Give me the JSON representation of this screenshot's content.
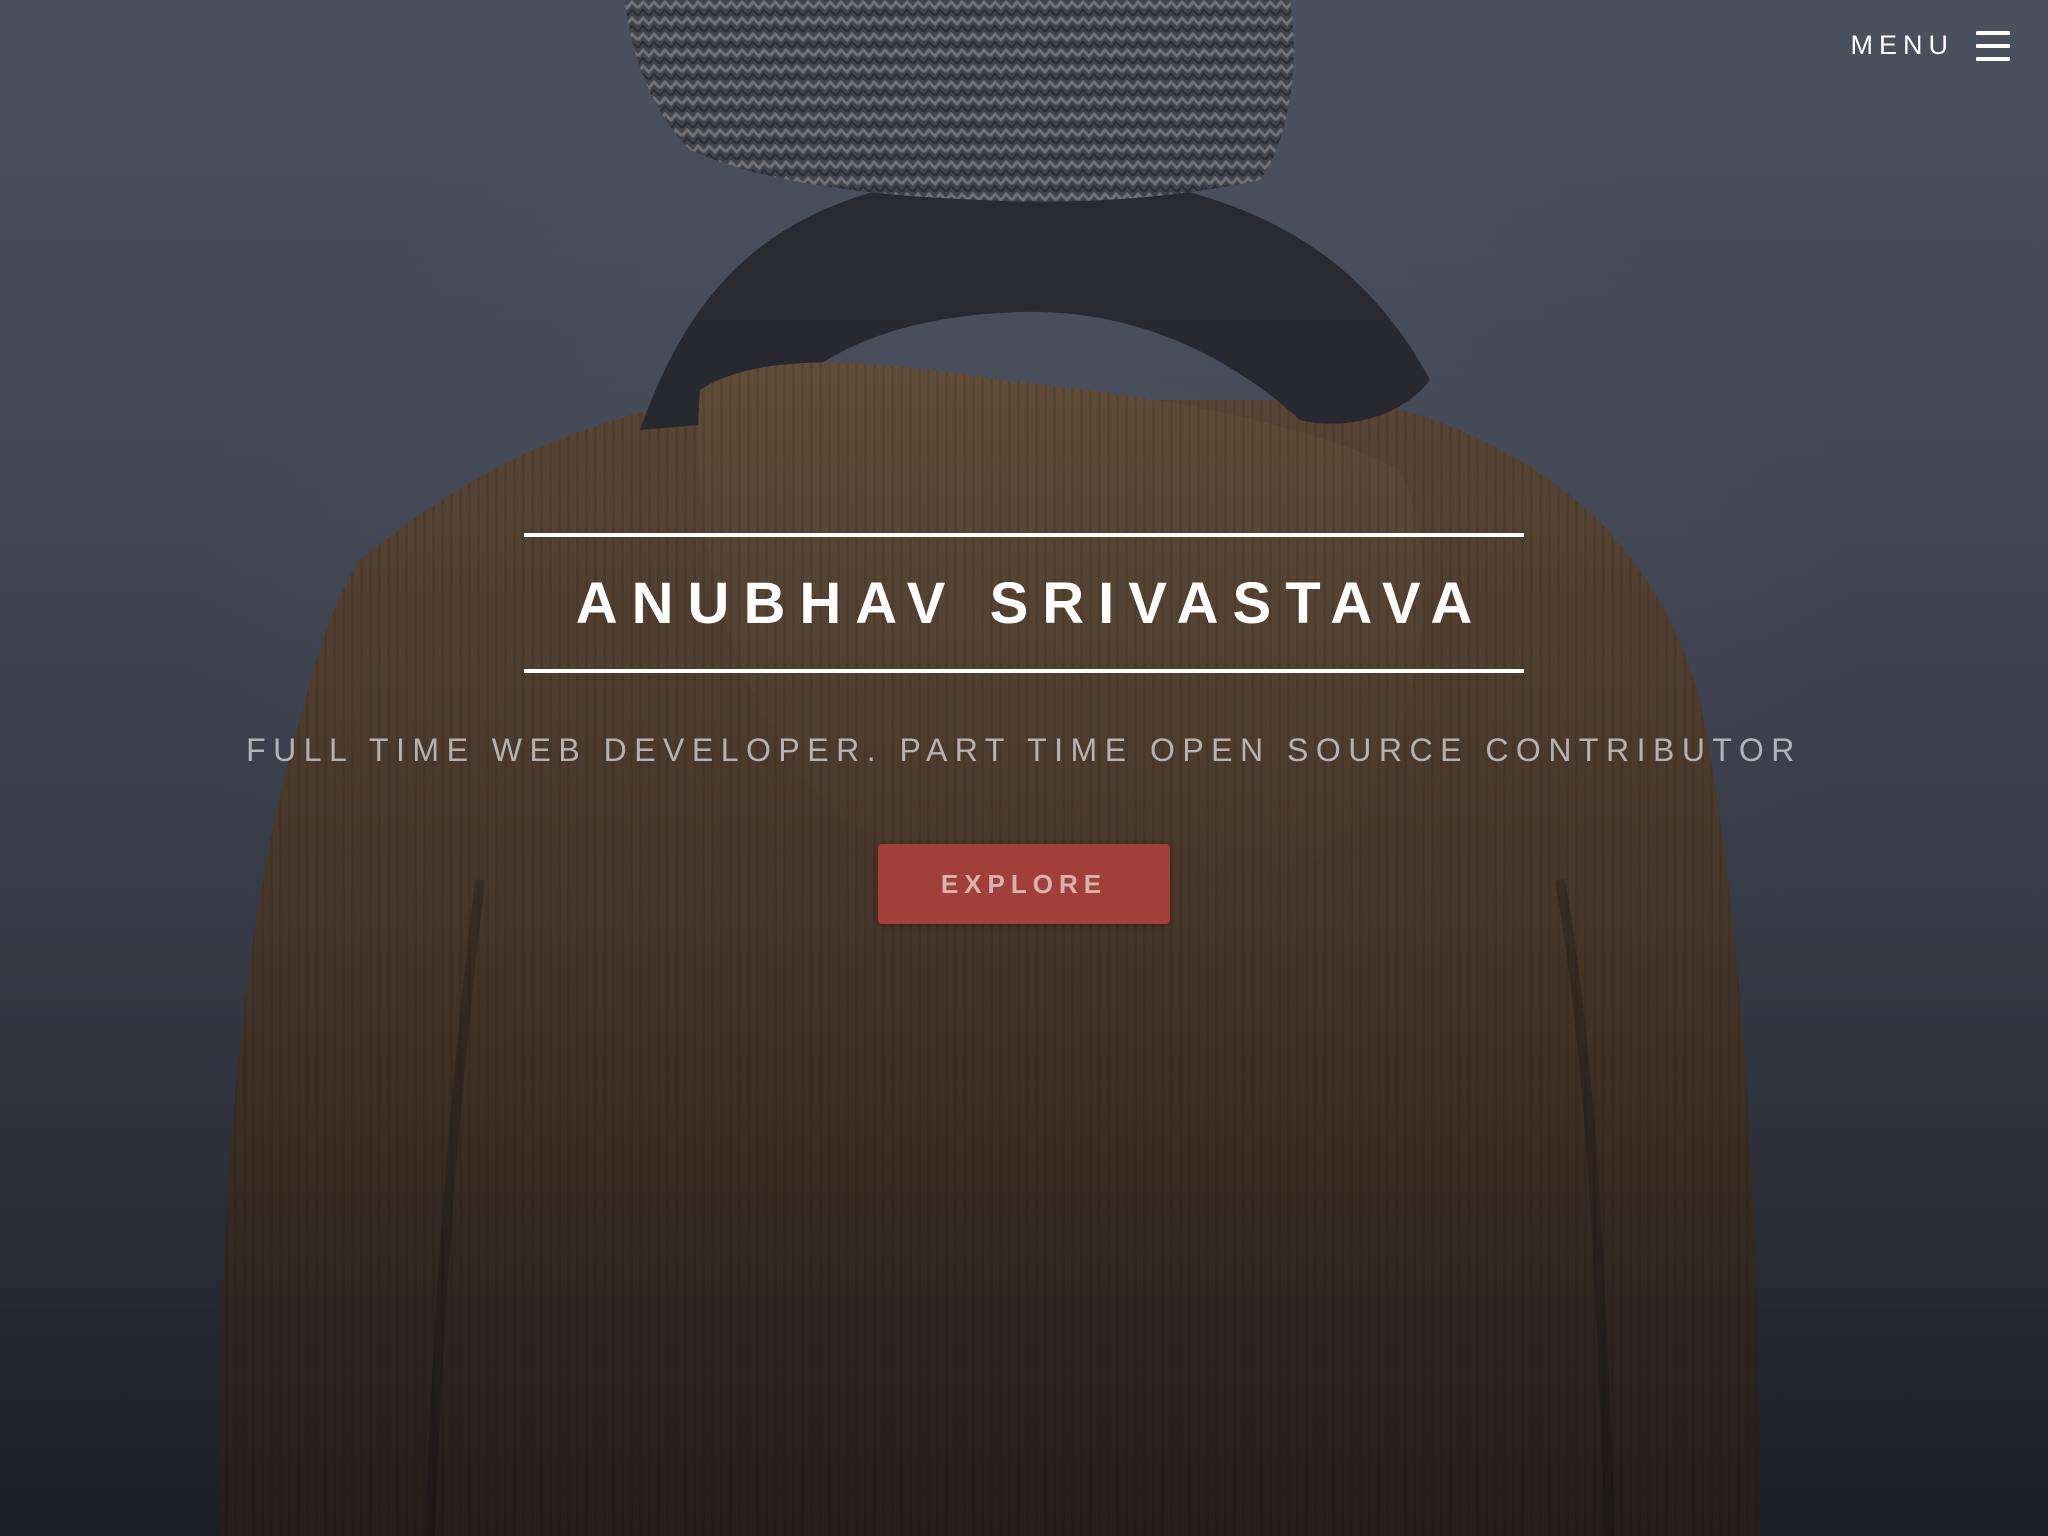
{
  "menu": {
    "label": "MENU",
    "icon": "hamburger-menu-icon"
  },
  "hero": {
    "title": "ANUBHAV SRIVASTAVA",
    "subtitle": "FULL TIME WEB DEVELOPER. PART TIME OPEN SOURCE CONTRIBUTOR",
    "cta_label": "EXPLORE"
  },
  "colors": {
    "background": "#4a5160",
    "accent": "#a23f39",
    "text": "#ffffff",
    "subtitle": "#c4c4c8",
    "jacket": "#6b4f33",
    "beanie": "#5a5a60"
  }
}
